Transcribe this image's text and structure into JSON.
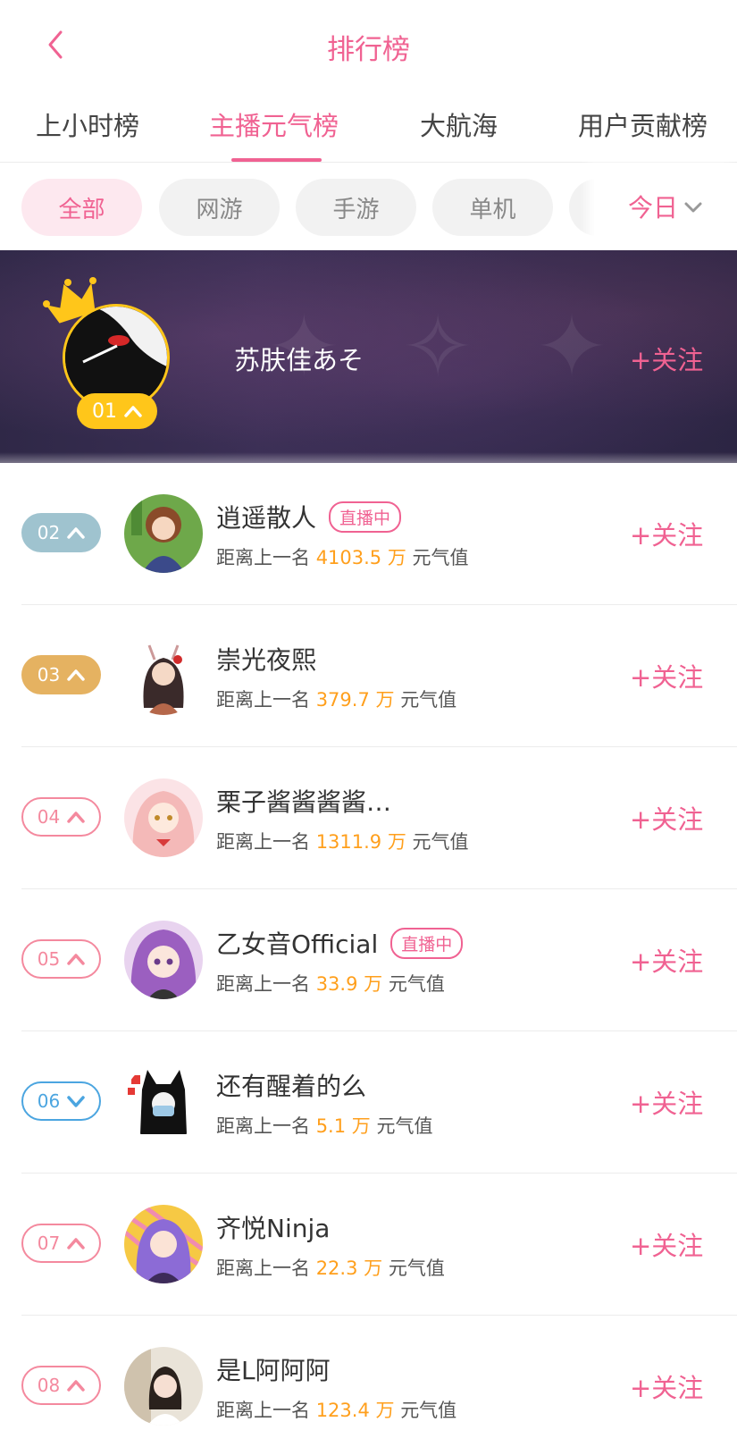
{
  "header": {
    "title": "排行榜",
    "back_icon": "chevron-left-icon"
  },
  "tabs": [
    {
      "label": "上小时榜",
      "active": false
    },
    {
      "label": "主播元气榜",
      "active": true
    },
    {
      "label": "大航海",
      "active": false
    },
    {
      "label": "用户贡献榜",
      "active": false
    }
  ],
  "filters": {
    "chips": [
      {
        "label": "全部",
        "active": true
      },
      {
        "label": "网游",
        "active": false
      },
      {
        "label": "手游",
        "active": false
      },
      {
        "label": "单机",
        "active": false
      }
    ],
    "date": {
      "label": "今日",
      "icon": "chevron-down-icon"
    }
  },
  "top": {
    "rank": "01",
    "trend": "up",
    "name": "苏肤佳あそ",
    "follow_label": "+关注"
  },
  "ranking": {
    "gap_prefix": "距离上一名",
    "gap_unit": "万",
    "gap_suffix": "元气值",
    "follow_label": "+关注",
    "live_label": "直播中",
    "items": [
      {
        "rank": "02",
        "trend": "up",
        "name": "逍遥散人",
        "gap": "4103.5",
        "live": true
      },
      {
        "rank": "03",
        "trend": "up",
        "name": "崇光夜熙",
        "gap": "379.7",
        "live": false
      },
      {
        "rank": "04",
        "trend": "up",
        "name": "栗子酱酱酱酱…",
        "gap": "1311.9",
        "live": false
      },
      {
        "rank": "05",
        "trend": "up",
        "name": "乙女音Official",
        "gap": "33.9",
        "live": true
      },
      {
        "rank": "06",
        "trend": "down",
        "name": "还有醒着的么",
        "gap": "5.1",
        "live": false
      },
      {
        "rank": "07",
        "trend": "up",
        "name": "齐悦Ninja",
        "gap": "22.3",
        "live": false
      },
      {
        "rank": "08",
        "trend": "up",
        "name": "是L阿阿阿",
        "gap": "123.4",
        "live": false
      }
    ]
  },
  "colors": {
    "accent": "#f06292",
    "gold": "#ffc61a",
    "orange_value": "#ff9f1c"
  }
}
